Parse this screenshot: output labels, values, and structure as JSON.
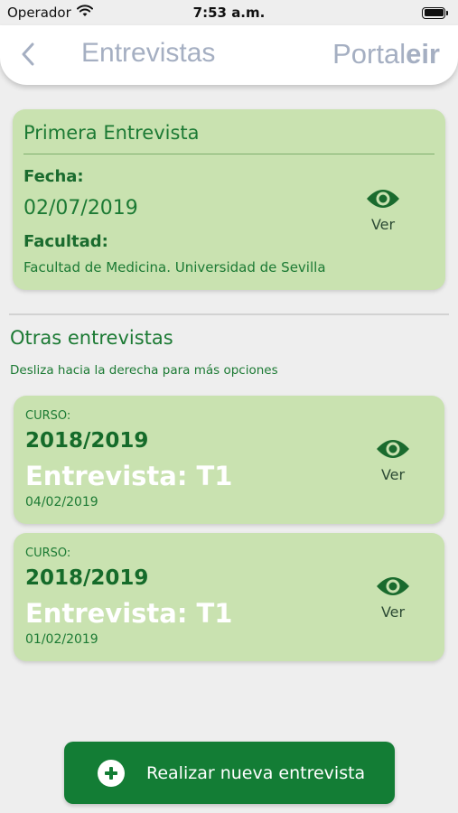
{
  "status_bar": {
    "carrier": "Operador",
    "time": "7:53 a.m."
  },
  "nav": {
    "title": "Entrevistas",
    "brand_regular": "Portal",
    "brand_bold": "eir"
  },
  "primary_interview": {
    "title": "Primera Entrevista",
    "date_label": "Fecha:",
    "date_value": "02/07/2019",
    "faculty_label": "Facultad:",
    "faculty_value": "Facultad de Medicina. Universidad de Sevilla",
    "view_label": "Ver"
  },
  "other_interviews": {
    "title": "Otras entrevistas",
    "hint": "Desliza hacia la derecha para más opciones",
    "items": [
      {
        "course_label": "CURSO:",
        "course": "2018/2019",
        "interview": "Entrevista: T1",
        "date": "04/02/2019",
        "view_label": "Ver"
      },
      {
        "course_label": "CURSO:",
        "course": "2018/2019",
        "interview": "Entrevista: T1",
        "date": "01/02/2019",
        "view_label": "Ver"
      }
    ]
  },
  "new_interview_button": {
    "label": "Realizar nueva entrevista"
  },
  "colors": {
    "card_bg": "#c9e2b0",
    "accent_green": "#137d35",
    "nav_text": "#a5afc2",
    "page_bg": "#eeeeee"
  }
}
